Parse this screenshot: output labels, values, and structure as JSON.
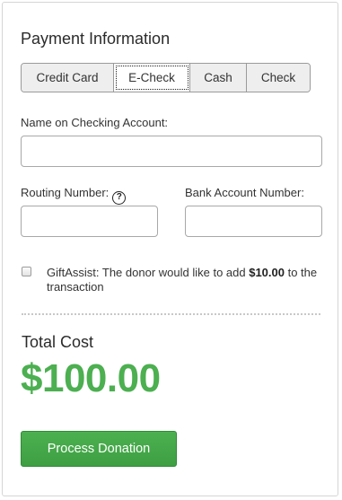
{
  "payment": {
    "title": "Payment Information",
    "tabs": [
      {
        "label": "Credit Card",
        "active": false
      },
      {
        "label": "E-Check",
        "active": true
      },
      {
        "label": "Cash",
        "active": false
      },
      {
        "label": "Check",
        "active": false
      }
    ]
  },
  "form": {
    "name_label": "Name on Checking Account:",
    "name_value": "",
    "routing_label": "Routing Number:",
    "routing_value": "",
    "routing_help_icon": "question-circle-icon",
    "bank_label": "Bank Account Number:",
    "bank_value": ""
  },
  "gift_assist": {
    "checked": false,
    "text_before": "GiftAssist: The donor would like to add ",
    "amount": "$10.00",
    "text_after": " to the transaction"
  },
  "total": {
    "label": "Total Cost",
    "amount": "$100.00"
  },
  "actions": {
    "process_label": "Process Donation"
  },
  "colors": {
    "accent_green": "#4caf50",
    "button_green": "#3d9f42"
  }
}
